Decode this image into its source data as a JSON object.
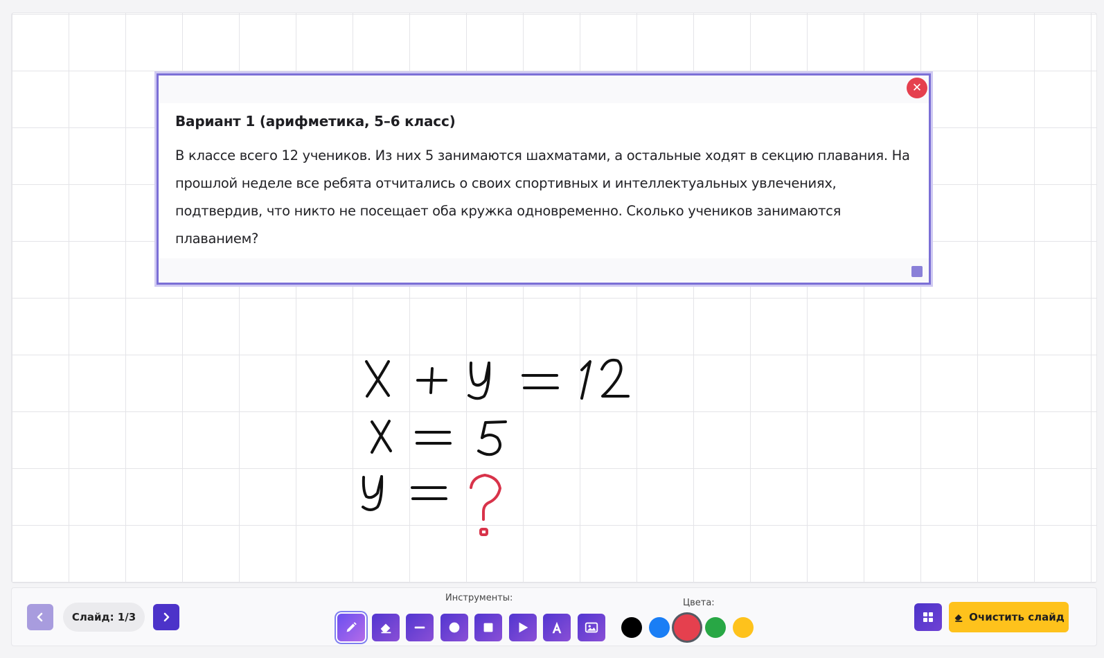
{
  "task": {
    "title": "Вариант 1 (арифметика, 5–6 класс)",
    "text": "В классе всего 12 учеников. Из них 5 занимаются шахматами, а остальные ходят в секцию плавания. На прошлой неделе все ребята отчитались о своих спортивных и интеллектуальных увлечениях, подтвердив, что никто не посещает оба кружка одновременно. Сколько учеников занимаются плаванием?",
    "close_glyph": "✕"
  },
  "handwriting": {
    "ink_color": "#111111",
    "highlight_color": "#d8334a",
    "lines": [
      "x + y = 12",
      "x = 5",
      "y = ?"
    ]
  },
  "toolbar": {
    "prev_icon": "chevron-left-icon",
    "next_icon": "chevron-right-icon",
    "slide_label": "Слайд: 1/3",
    "tools_label": "Инструменты:",
    "colors_label": "Цвета:",
    "tools": [
      {
        "icon": "pencil-icon",
        "active": true
      },
      {
        "icon": "eraser-icon",
        "active": false
      },
      {
        "icon": "line-icon",
        "active": false
      },
      {
        "icon": "circle-icon",
        "active": false
      },
      {
        "icon": "square-icon",
        "active": false
      },
      {
        "icon": "triangle-icon",
        "active": false
      },
      {
        "icon": "text-icon",
        "active": false
      },
      {
        "icon": "image-icon",
        "active": false
      }
    ],
    "colors": [
      {
        "name": "black",
        "hex": "#000000",
        "active": false
      },
      {
        "name": "blue",
        "hex": "#1a7ef5",
        "active": false
      },
      {
        "name": "red",
        "hex": "#e5404e",
        "active": true
      },
      {
        "name": "green",
        "hex": "#28a745",
        "active": false
      },
      {
        "name": "yellow",
        "hex": "#fec21c",
        "active": false
      }
    ],
    "grid_icon": "grid-icon",
    "clear_label": "Очистить слайд",
    "clear_icon": "eraser-icon"
  }
}
